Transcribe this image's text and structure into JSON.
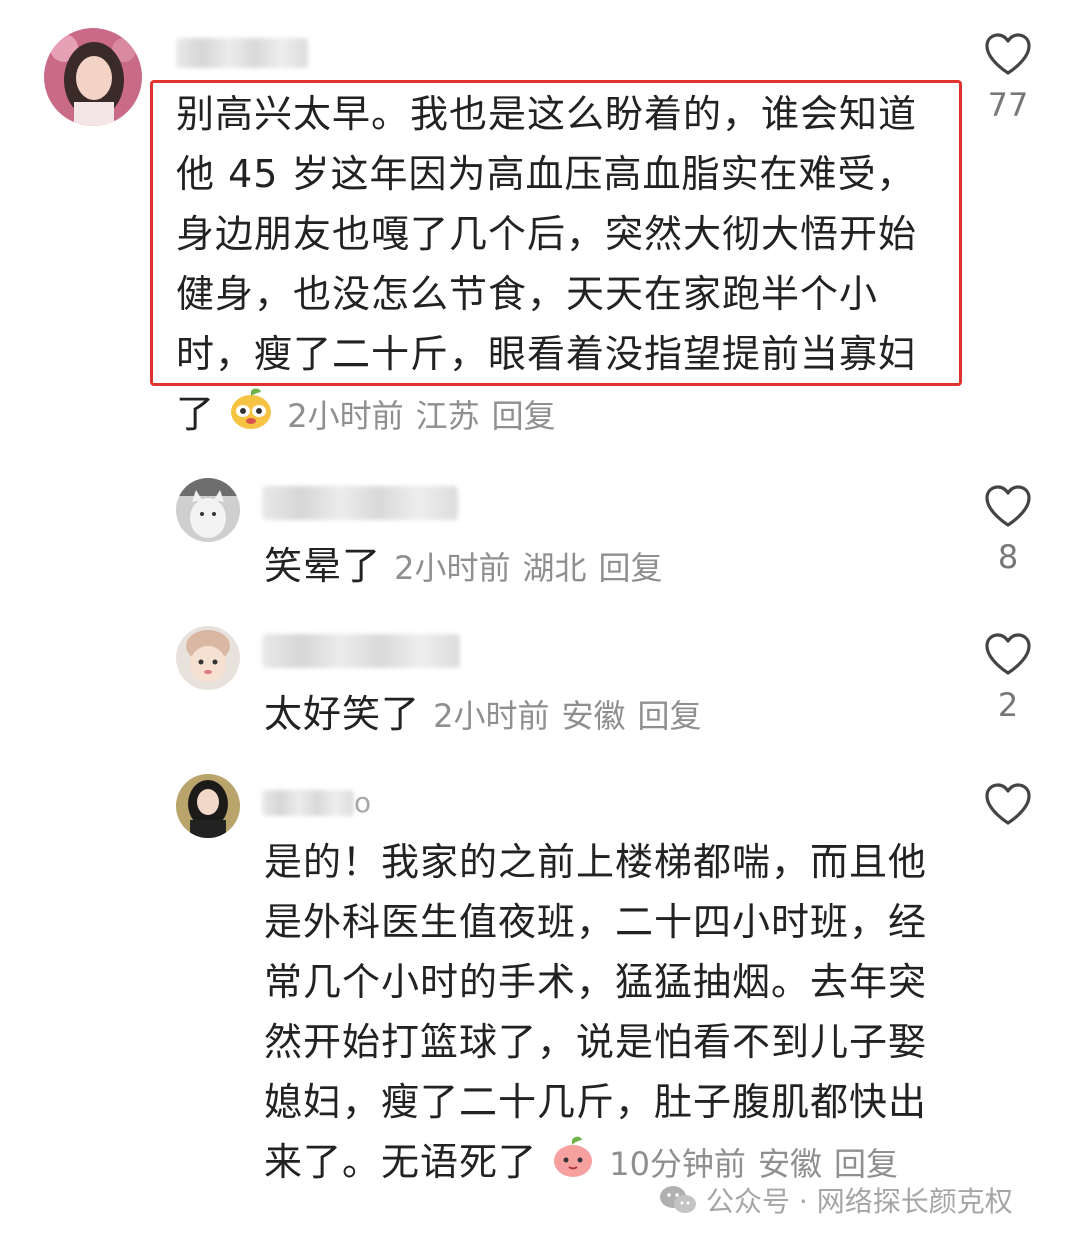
{
  "comments": [
    {
      "text_lines": [
        "别高兴太早。我也是这么盼着的，谁会知道",
        "他 45 岁这年因为高血压高血脂实在难受，",
        "身边朋友也嘎了几个后，突然大彻大悟开始",
        "健身，也没怎么节食，天天在家跑半个小",
        "时，瘦了二十斤，眼看着没指望提前当寡妇",
        "了"
      ],
      "time": "2小时前",
      "location": "江苏",
      "reply": "回复",
      "likes": "77"
    },
    {
      "text": "笑晕了",
      "time": "2小时前",
      "location": "湖北",
      "reply": "回复",
      "likes": "8"
    },
    {
      "text": "太好笑了",
      "time": "2小时前",
      "location": "安徽",
      "reply": "回复",
      "likes": "2"
    },
    {
      "username_suffix": "o",
      "text_lines": [
        "是的！我家的之前上楼梯都喘，而且他",
        "是外科医生值夜班，二十四小时班，经",
        "常几个小时的手术，猛猛抽烟。去年突",
        "然开始打篮球了，说是怕看不到儿子娶",
        "媳妇，瘦了二十几斤，肚子腹肌都快出",
        "来了。无语死了"
      ],
      "time": "10分钟前",
      "location": "安徽",
      "reply": "回复",
      "likes": ""
    }
  ],
  "watermark": "公众号 · 网络探长颜克权",
  "colors": {
    "highlight": "#e0332f",
    "meta": "#8f8f8f",
    "text": "#222222"
  }
}
